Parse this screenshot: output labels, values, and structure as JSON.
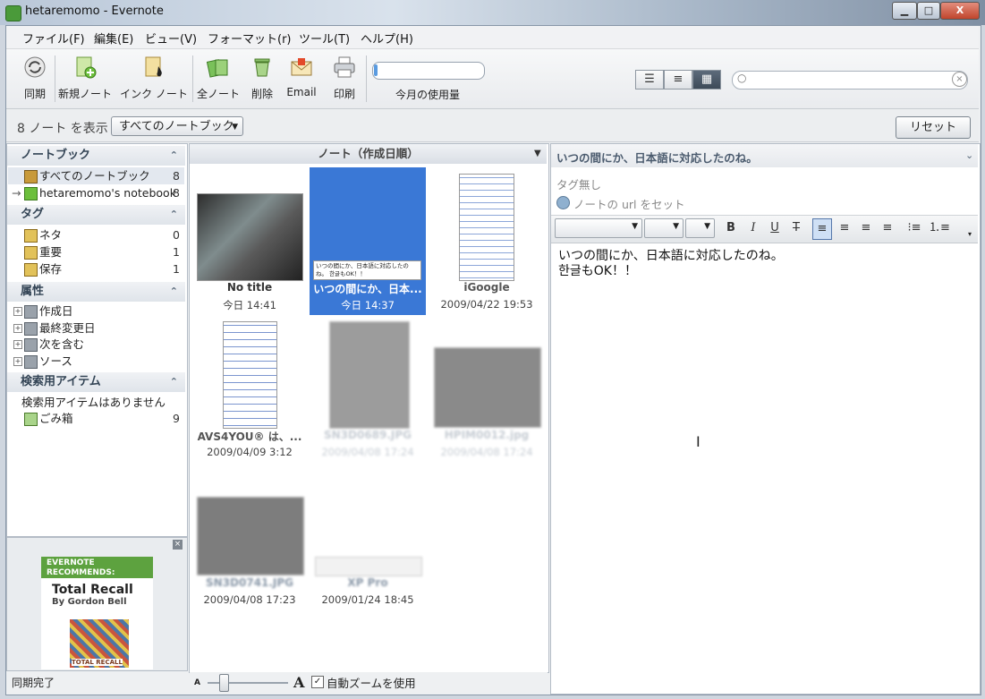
{
  "window": {
    "title": "hetaremomo - Evernote",
    "min": "▁",
    "max": "□",
    "close": "X"
  },
  "menu": [
    "ファイル(F)",
    "編集(E)",
    "ビュー(V)",
    "フォーマット(r)",
    "ツール(T)",
    "ヘルプ(H)"
  ],
  "toolbar": {
    "sync": "同期",
    "new_note": "新規ノート",
    "ink_note": "インク ノート",
    "all_notes": "全ノート",
    "delete": "削除",
    "email": "Email",
    "print": "印刷",
    "usage_label": "今月の使用量",
    "usage_fraction": 0.02
  },
  "view_icons": [
    "list-icon",
    "detail-list-icon",
    "thumbnail-grid-icon"
  ],
  "filter": {
    "count_text": "8 ノート を表示",
    "notebook_select": "すべてのノートブック",
    "reset": "リセット"
  },
  "sidebar": {
    "notebooks_header": "ノートブック",
    "notebooks": [
      {
        "label": "すべてのノートブック",
        "count": "8"
      },
      {
        "label": "hetaremomo's notebook",
        "count": "8"
      }
    ],
    "tags_header": "タグ",
    "tags": [
      {
        "label": "ネタ",
        "count": "0"
      },
      {
        "label": "重要",
        "count": "1"
      },
      {
        "label": "保存",
        "count": "1"
      }
    ],
    "attributes_header": "属性",
    "attributes": [
      "作成日",
      "最終変更日",
      "次を含む",
      "ソース"
    ],
    "saved_header": "検索用アイテム",
    "saved_empty": "検索用アイテムはありません",
    "trash": {
      "label": "ごみ箱",
      "count": "9"
    }
  },
  "ad": {
    "header_line1": "EVERNOTE",
    "header_line2": "RECOMMENDS:",
    "title": "Total Recall",
    "author": "By Gordon Bell",
    "cover_text": "TOTAL RECALL"
  },
  "status": "同期完了",
  "notes_header": "ノート（作成日順）",
  "notes": [
    {
      "title": "No title",
      "date": "今日 14:41"
    },
    {
      "title": "いつの間にか、日本...",
      "date": "今日 14:37"
    },
    {
      "title": "iGoogle",
      "date": "2009/04/22 19:53"
    },
    {
      "title": "AVS4YOU® は、...",
      "date": "2009/04/09 3:12"
    },
    {
      "title": "SN3D0689.JPG",
      "date": "2009/04/08 17:24"
    },
    {
      "title": "HPIM0012.jpg",
      "date": "2009/04/08 17:24"
    },
    {
      "title": "SN3D0741.JPG",
      "date": "2009/04/08 17:23"
    },
    {
      "title": "XP Pro",
      "date": "2009/01/24 18:45"
    }
  ],
  "selected_thumb_text": "いつの間にか、日本語に対応したのね。 한글もOK！！",
  "zoom": {
    "small_a": "A",
    "big_a": "A",
    "auto_zoom_label": "自動ズームを使用",
    "checked": "✓"
  },
  "note": {
    "title": "いつの間にか、日本語に対応したのね。",
    "tags": "タグ無し",
    "url_placeholder": "ノートの url をセット",
    "body_line1": "いつの間にか、日本語に対応したのね。",
    "body_line2": "한글もOK！！"
  },
  "format": {
    "bold": "B",
    "italic": "I",
    "underline": "U",
    "strike": "T"
  },
  "colors": {
    "selected": "#3a78d6",
    "ad_green": "#5da23f",
    "header_text": "#345566"
  }
}
